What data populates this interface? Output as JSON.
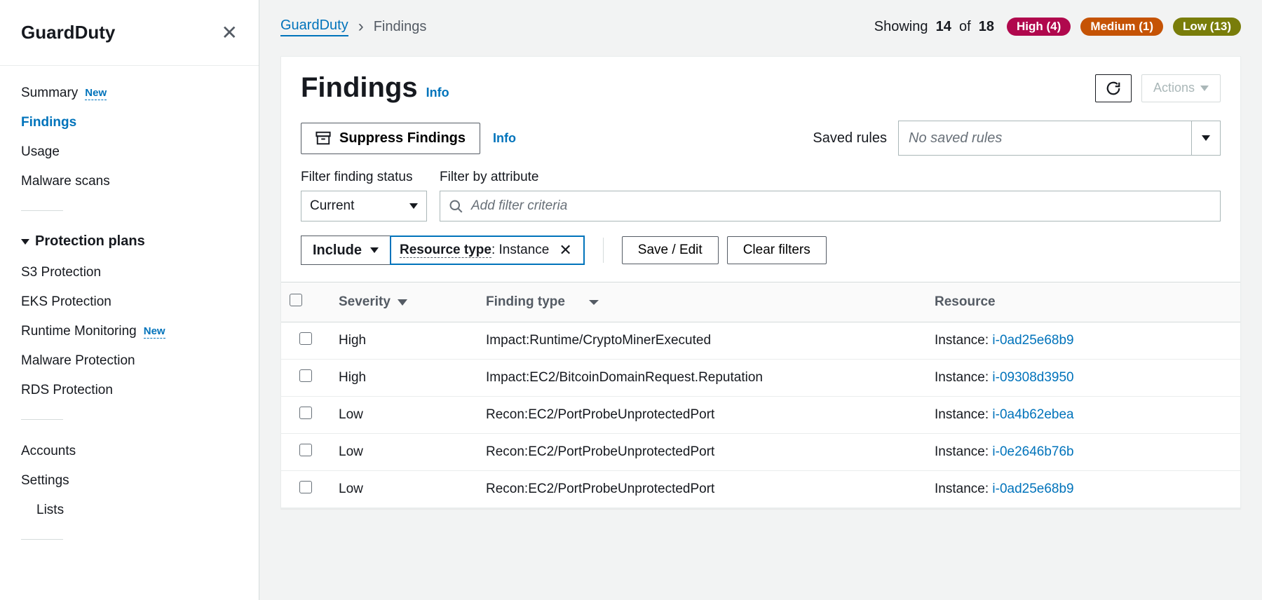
{
  "sidebar": {
    "title": "GuardDuty",
    "items": [
      {
        "label": "Summary",
        "badge": "New"
      },
      {
        "label": "Findings",
        "active": true
      },
      {
        "label": "Usage"
      },
      {
        "label": "Malware scans"
      }
    ],
    "protection_section": {
      "title": "Protection plans",
      "items": [
        {
          "label": "S3 Protection"
        },
        {
          "label": "EKS Protection"
        },
        {
          "label": "Runtime Monitoring",
          "badge": "New"
        },
        {
          "label": "Malware Protection"
        },
        {
          "label": "RDS Protection"
        }
      ]
    },
    "bottom_items": [
      {
        "label": "Accounts"
      },
      {
        "label": "Settings"
      },
      {
        "label": "Lists",
        "indent": true
      }
    ]
  },
  "breadcrumb": {
    "root": "GuardDuty",
    "current": "Findings"
  },
  "showing": {
    "prefix": "Showing",
    "shown": "14",
    "of_word": "of",
    "total": "18"
  },
  "severity_badges": {
    "high": "High (4)",
    "medium": "Medium (1)",
    "low": "Low (13)"
  },
  "page": {
    "title": "Findings",
    "info": "Info",
    "actions_label": "Actions",
    "suppress_label": "Suppress Findings",
    "saved_rules_label": "Saved rules",
    "saved_rules_placeholder": "No saved rules",
    "filter_status_label": "Filter finding status",
    "filter_status_value": "Current",
    "filter_attr_label": "Filter by attribute",
    "filter_attr_placeholder": "Add filter criteria",
    "include_label": "Include",
    "filter_chip_key": "Resource type",
    "filter_chip_value": "Instance",
    "save_edit_label": "Save / Edit",
    "clear_filters_label": "Clear filters"
  },
  "table": {
    "headers": {
      "severity": "Severity",
      "finding_type": "Finding type",
      "resource": "Resource"
    },
    "resource_prefix": "Instance: ",
    "rows": [
      {
        "severity": "High",
        "finding_type": "Impact:Runtime/CryptoMinerExecuted",
        "resource_id": "i-0ad25e68b9"
      },
      {
        "severity": "High",
        "finding_type": "Impact:EC2/BitcoinDomainRequest.Reputation",
        "resource_id": "i-09308d3950"
      },
      {
        "severity": "Low",
        "finding_type": "Recon:EC2/PortProbeUnprotectedPort",
        "resource_id": "i-0a4b62ebea"
      },
      {
        "severity": "Low",
        "finding_type": "Recon:EC2/PortProbeUnprotectedPort",
        "resource_id": "i-0e2646b76b"
      },
      {
        "severity": "Low",
        "finding_type": "Recon:EC2/PortProbeUnprotectedPort",
        "resource_id": "i-0ad25e68b9"
      }
    ]
  }
}
